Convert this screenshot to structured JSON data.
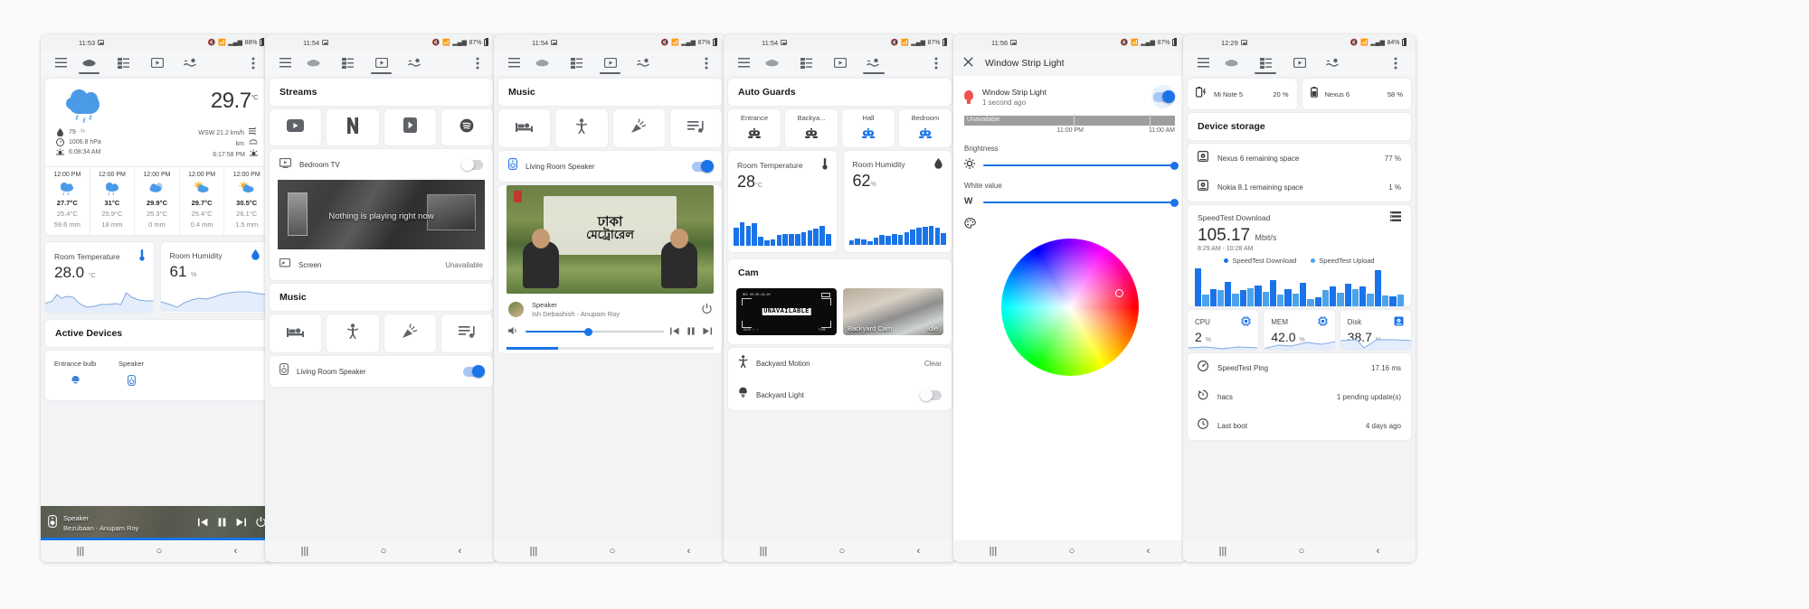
{
  "colors": {
    "accent": "#1a73e8",
    "robot_active": "#1a73e8",
    "robot_idle": "#3c4043",
    "bulb": "#ef5350",
    "cloud": "#4a9ae8",
    "sun": "#f9b22a"
  },
  "phone1": {
    "status": {
      "time": "11:53",
      "battery": "88%"
    },
    "toolbar": {
      "menu": "menu-icon",
      "tabs": [
        "weather-tab",
        "server-tab",
        "media-tab",
        "water-tab"
      ],
      "active": 0,
      "overflow": "more-vert-icon"
    },
    "weather": {
      "temperature": "29.7",
      "unit": "°C",
      "humidity": "79",
      "humidity_unit": "%",
      "pressure": "1006.8 hPa",
      "sunrise": "6:08:34 AM",
      "wind": "WSW 21.2 km/h",
      "visibility": "km",
      "sunset": "6:17:58 PM",
      "forecast": [
        {
          "time": "12:00 PM",
          "icon": "rain",
          "high": "27.7°C",
          "low": "25.4°C",
          "precip": "59.6 mm"
        },
        {
          "time": "12:00 PM",
          "icon": "rain",
          "high": "31°C",
          "low": "25.9°C",
          "precip": "18 mm"
        },
        {
          "time": "12:00 PM",
          "icon": "cloud",
          "high": "29.9°C",
          "low": "25.3°C",
          "precip": "0 mm"
        },
        {
          "time": "12:00 PM",
          "icon": "partly",
          "high": "29.7°C",
          "low": "25.4°C",
          "precip": "0.4 mm"
        },
        {
          "time": "12:00 PM",
          "icon": "partly",
          "high": "30.5°C",
          "low": "26.1°C",
          "precip": "1.5 mm"
        }
      ]
    },
    "sensors": [
      {
        "label": "Room Temperature",
        "icon": "thermometer-icon",
        "value": "28.0",
        "unit": "°C"
      },
      {
        "label": "Room Humidity",
        "icon": "humidity-icon",
        "value": "61",
        "unit": "%"
      }
    ],
    "active_devices": {
      "title": "Active Devices",
      "items": [
        {
          "label": "Entrance bulb",
          "icon": "bulb-icon"
        },
        {
          "label": "Speaker",
          "icon": "speaker-icon"
        }
      ]
    },
    "player": {
      "title": "Speaker",
      "subtitle": "Bezubaan - Anupam Roy",
      "controls": [
        "prev-icon",
        "pause-icon",
        "next-icon",
        "power-icon"
      ],
      "progress": "100"
    },
    "nav": {
      "recents": "|||",
      "home": "○",
      "back": "‹"
    }
  },
  "phone2": {
    "status": {
      "time": "11:54",
      "battery": "87%"
    },
    "toolbar": {
      "active": 2
    },
    "streams": {
      "title": "Streams",
      "apps": [
        "youtube-icon",
        "netflix-icon",
        "prime-video-icon",
        "spotify-icon"
      ]
    },
    "device": {
      "name": "Bedroom TV",
      "icon": "tv-icon",
      "toggle": "off"
    },
    "preview": {
      "text": "Nothing is playing right now"
    },
    "screen_row": {
      "label": "Screen",
      "value": "Unavailable",
      "icon": "cast-icon"
    },
    "music": {
      "title": "Music",
      "apps": [
        "bed-icon",
        "person-icon",
        "party-icon",
        "playlist-icon"
      ]
    },
    "speaker": {
      "name": "Living Room Speaker",
      "icon": "speaker-icon",
      "toggle": "on"
    },
    "nav": {
      "recents": "|||",
      "home": "○",
      "back": "‹"
    }
  },
  "phone3": {
    "status": {
      "time": "11:54",
      "battery": "87%"
    },
    "toolbar": {
      "active": 2
    },
    "music": {
      "title": "Music",
      "apps": [
        "bed-icon",
        "person-icon",
        "party-icon",
        "playlist-icon"
      ]
    },
    "speaker_row": {
      "name": "Living Room Speaker",
      "icon": "speaker-icon",
      "toggle": "on"
    },
    "album": {
      "line1": "ঢাকা",
      "line2": "মেট্রোরেল"
    },
    "now_playing": {
      "title": "Speaker",
      "subtitle": "Ish Debashish - Anupam Roy",
      "power": "power-icon"
    },
    "controls": {
      "volume": "volume-icon",
      "prev": "prev-icon",
      "pause": "pause-icon",
      "next": "next-icon"
    },
    "nav": {
      "recents": "|||",
      "home": "○",
      "back": "‹"
    }
  },
  "phone4": {
    "status": {
      "time": "11:54",
      "battery": "87%"
    },
    "toolbar": {
      "active": 3
    },
    "guards": {
      "title": "Auto Guards",
      "items": [
        {
          "label": "Entrance",
          "state": "idle"
        },
        {
          "label": "Backya...",
          "state": "idle"
        },
        {
          "label": "Hall",
          "state": "active"
        },
        {
          "label": "Bedroom",
          "state": "active"
        }
      ]
    },
    "sensors": [
      {
        "label": "Room Temperature",
        "icon": "thermometer-icon",
        "value": "28",
        "unit": "°C"
      },
      {
        "label": "Room Humidity",
        "icon": "humidity-icon",
        "value": "62",
        "unit": "%"
      }
    ],
    "temp_bars": [
      62,
      80,
      70,
      78,
      30,
      20,
      22,
      38,
      40,
      42,
      40,
      46,
      52,
      60,
      68,
      40
    ],
    "hum_bars": [
      16,
      22,
      20,
      12,
      26,
      34,
      30,
      38,
      34,
      44,
      52,
      58,
      62,
      66,
      58,
      40
    ],
    "cam": {
      "title": "Cam",
      "left": {
        "overlay": "UNAVAILABLE",
        "rec": "REC 00:00:19:20",
        "date": "DATE  /  /",
        "time": "TIME"
      },
      "right": {
        "name": "Backyard Cam",
        "status": "Idle"
      }
    },
    "rows": [
      {
        "icon": "motion-icon",
        "label": "Backyard Motion",
        "value": "Clear"
      },
      {
        "icon": "bulb-icon",
        "label": "Backyard Light",
        "toggle": "off"
      }
    ],
    "nav": {
      "recents": "|||",
      "home": "○",
      "back": "‹"
    }
  },
  "phone5": {
    "status": {
      "time": "11:56",
      "battery": "87%"
    },
    "appbar": {
      "close": "close-icon",
      "title": "Window Strip Light"
    },
    "device": {
      "name": "Window Strip Light",
      "subtitle": "1 second ago",
      "toggle": "on",
      "icon": "bulb-icon"
    },
    "history": {
      "state": "Unavailable",
      "left_label": "11:00 PM",
      "right_label": "11:00 AM"
    },
    "brightness": {
      "label": "Brightness",
      "icon": "brightness-icon",
      "value": "100"
    },
    "white_value": {
      "label": "White value",
      "icon": "white-balance-icon",
      "value": "100"
    },
    "color_wheel": {
      "icon": "palette-icon"
    },
    "nav": {
      "recents": "|||",
      "home": "○",
      "back": "‹"
    }
  },
  "phone6": {
    "status": {
      "time": "12:29",
      "battery": "84%"
    },
    "toolbar": {
      "active": 1
    },
    "batteries": [
      {
        "name": "Mi Note 5",
        "pct": "20 %",
        "icon": "battery-charging-icon"
      },
      {
        "name": "Nexus 6",
        "pct": "58 %",
        "icon": "battery-icon"
      }
    ],
    "storage": {
      "title": "Device storage",
      "items": [
        {
          "icon": "disk-icon",
          "label": "Nexus 6 remaining space",
          "value": "77 %"
        },
        {
          "icon": "disk-icon",
          "label": "Nokia 8.1 remaining space",
          "value": "1 %"
        }
      ]
    },
    "speedtest": {
      "title": "SpeedTest Download",
      "menu_icon": "list-icon",
      "value": "105.17",
      "unit": "Mbit/s",
      "range": "8:29 AM - 10:28 AM",
      "legend": [
        {
          "name": "SpeedTest Download",
          "color": "#1a73e8"
        },
        {
          "name": "SpeedTest Upload",
          "color": "#4ba3ec"
        }
      ]
    },
    "chart_data": {
      "type": "bar",
      "title": "SpeedTest Download",
      "xlabel": "",
      "ylabel": "Mbit/s",
      "series": [
        {
          "name": "SpeedTest Download",
          "color": "#1a73e8",
          "values": [
            100,
            46,
            64,
            42,
            54,
            70,
            46,
            62,
            24,
            52,
            60,
            52,
            96,
            26
          ]
        },
        {
          "name": "SpeedTest Upload",
          "color": "#4ba3ec",
          "values": [
            30,
            44,
            34,
            48,
            38,
            30,
            34,
            18,
            44,
            36,
            46,
            34,
            28,
            30
          ]
        }
      ],
      "legend_position": "top"
    },
    "stats": [
      {
        "label": "CPU",
        "icon": "cpu-icon",
        "value": "2",
        "unit": "%"
      },
      {
        "label": "MEM",
        "icon": "cpu-icon",
        "value": "42.0",
        "unit": "%"
      },
      {
        "label": "Disk",
        "icon": "disk-icon",
        "value": "38.7",
        "unit": "%"
      }
    ],
    "rows": [
      {
        "icon": "speed-icon",
        "label": "SpeedTest Ping",
        "value": "17.16 ms"
      },
      {
        "icon": "update-icon",
        "label": "hacs",
        "value": "1 pending update(s)"
      },
      {
        "icon": "clock-icon",
        "label": "Last boot",
        "value": "4 days ago"
      }
    ],
    "nav": {
      "recents": "|||",
      "home": "○",
      "back": "‹"
    }
  }
}
